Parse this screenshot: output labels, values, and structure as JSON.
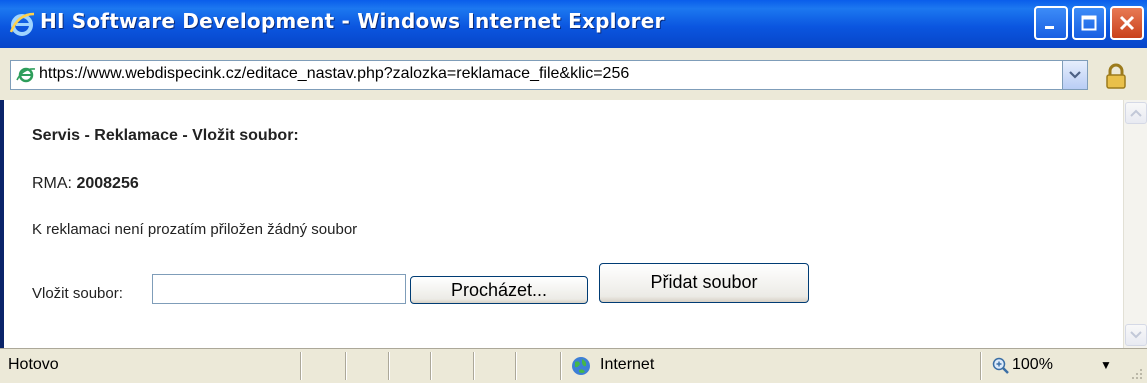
{
  "window": {
    "title": "HI Software Development - Windows Internet Explorer",
    "title_bar_color": "#0A5EEB"
  },
  "address": {
    "url": "https://www.webdispecink.cz/editace_nastav.php?zalozka=reklamace_file&klic=256",
    "page_icon": "ie-page-icon",
    "lock_icon": "lock-icon"
  },
  "page": {
    "heading": "Servis - Reklamace - Vložit soubor:",
    "rma_label": "RMA: ",
    "rma_value": "2008256",
    "no_file_text": "K reklamaci není prozatím přiložen žádný soubor",
    "upload_label": "Vložit soubor:",
    "file_input_value": "",
    "browse_label": "Procházet...",
    "add_file_label": "Přidat soubor"
  },
  "status": {
    "text": "Hotovo",
    "zone": "Internet",
    "zoom": "100%"
  }
}
